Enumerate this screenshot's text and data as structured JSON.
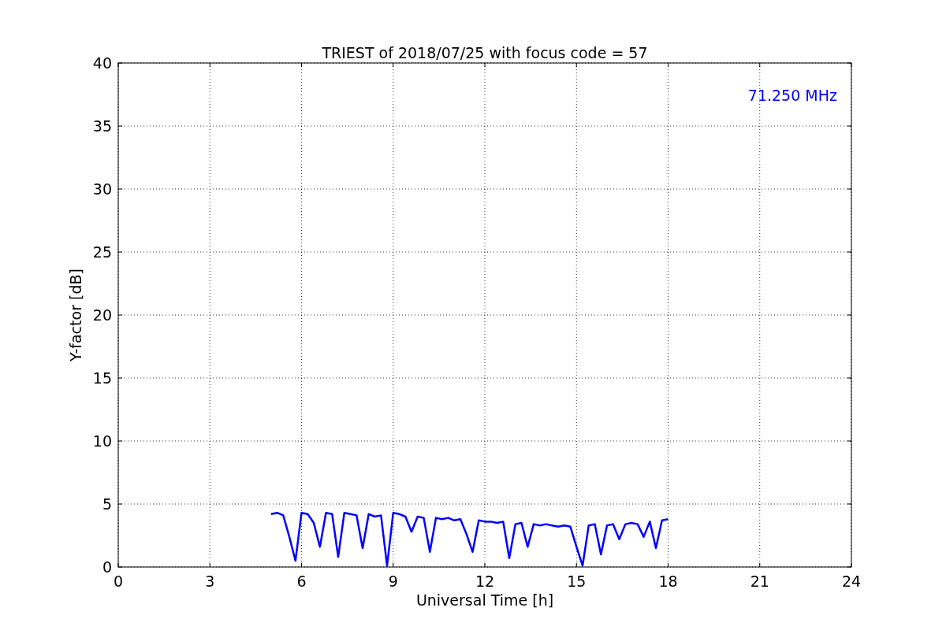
{
  "chart_data": {
    "type": "line",
    "title": "TRIEST of 2018/07/25 with focus code = 57",
    "xlabel": "Universal Time [h]",
    "ylabel": "Y-factor [dB]",
    "x": [
      5.0,
      5.2,
      5.4,
      5.6,
      5.8,
      6.0,
      6.2,
      6.4,
      6.6,
      6.8,
      7.0,
      7.2,
      7.4,
      7.6,
      7.8,
      8.0,
      8.2,
      8.4,
      8.6,
      8.8,
      9.0,
      9.2,
      9.4,
      9.6,
      9.8,
      10.0,
      10.2,
      10.4,
      10.6,
      10.8,
      11.0,
      11.2,
      11.4,
      11.6,
      11.8,
      12.0,
      12.2,
      12.4,
      12.6,
      12.8,
      13.0,
      13.2,
      13.4,
      13.6,
      13.8,
      14.0,
      14.2,
      14.4,
      14.6,
      14.8,
      15.0,
      15.2,
      15.4,
      15.6,
      15.8,
      16.0,
      16.2,
      16.4,
      16.6,
      16.8,
      17.0,
      17.2,
      17.4,
      17.6,
      17.8,
      18.0
    ],
    "series": [
      {
        "name": "71.250 MHz",
        "color": "#0000ff",
        "values": [
          4.2,
          4.3,
          4.1,
          2.4,
          0.5,
          4.3,
          4.2,
          3.5,
          1.6,
          4.3,
          4.2,
          0.8,
          4.3,
          4.2,
          4.1,
          1.5,
          4.2,
          4.0,
          4.1,
          0.1,
          4.3,
          4.2,
          4.0,
          2.8,
          4.0,
          3.9,
          1.2,
          3.9,
          3.8,
          3.9,
          3.7,
          3.8,
          2.6,
          1.2,
          3.7,
          3.6,
          3.6,
          3.5,
          3.6,
          0.7,
          3.4,
          3.5,
          1.6,
          3.4,
          3.3,
          3.4,
          3.3,
          3.2,
          3.3,
          3.2,
          1.6,
          0.1,
          3.3,
          3.4,
          1.0,
          3.3,
          3.4,
          2.2,
          3.4,
          3.5,
          3.4,
          2.4,
          3.6,
          1.5,
          3.7,
          3.8
        ]
      }
    ],
    "xlim": [
      0,
      24
    ],
    "ylim": [
      0,
      40
    ],
    "xticks": [
      0,
      3,
      6,
      9,
      12,
      15,
      18,
      21,
      24
    ],
    "yticks": [
      0,
      5,
      10,
      15,
      20,
      25,
      30,
      35,
      40
    ],
    "grid": true
  }
}
